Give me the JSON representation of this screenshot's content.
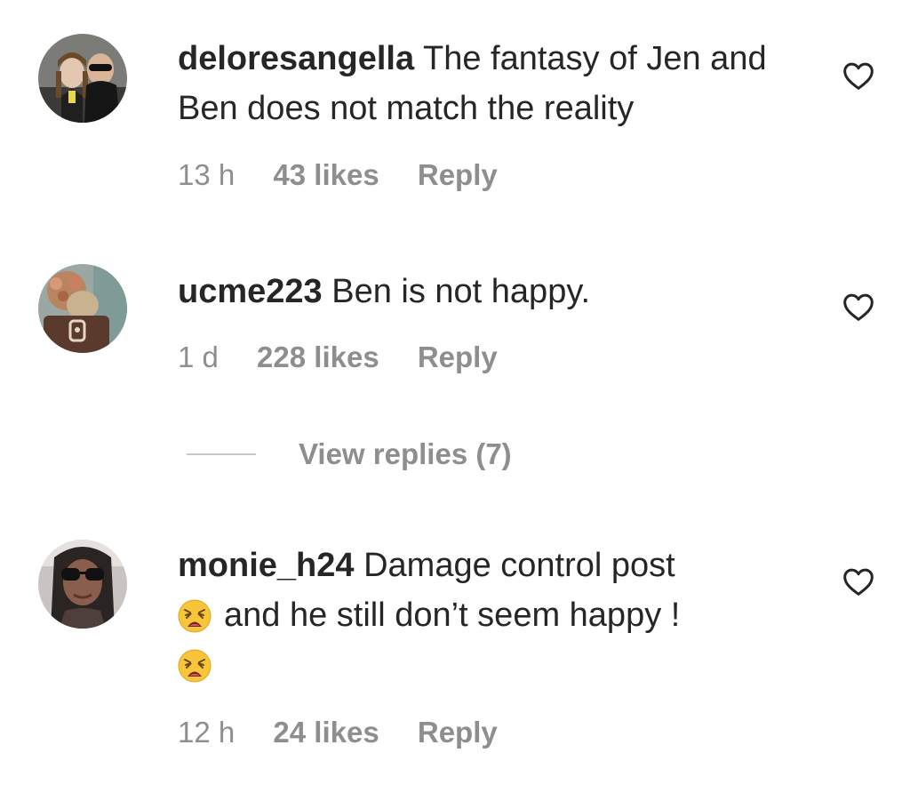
{
  "comments": [
    {
      "username": "deloresangella",
      "text": "The fantasy of Jen and Ben does not match the reality",
      "time": "13 h",
      "likes": "43 likes",
      "reply_label": "Reply"
    },
    {
      "username": "ucme223",
      "text": "Ben is not happy.",
      "time": "1 d",
      "likes": "228 likes",
      "reply_label": "Reply"
    },
    {
      "username": "monie_h24",
      "text_part1": "Damage control post",
      "text_part2": "and he still don’t seem happy !",
      "emoji": "weary-face",
      "time": "12 h",
      "likes": "24 likes",
      "reply_label": "Reply"
    }
  ],
  "view_replies": {
    "label": "View replies (7)"
  },
  "icons": {
    "like": "heart-outline-icon"
  },
  "colors": {
    "text": "#262626",
    "secondary": "#8e8e8e",
    "divider": "#c7c7c7"
  }
}
